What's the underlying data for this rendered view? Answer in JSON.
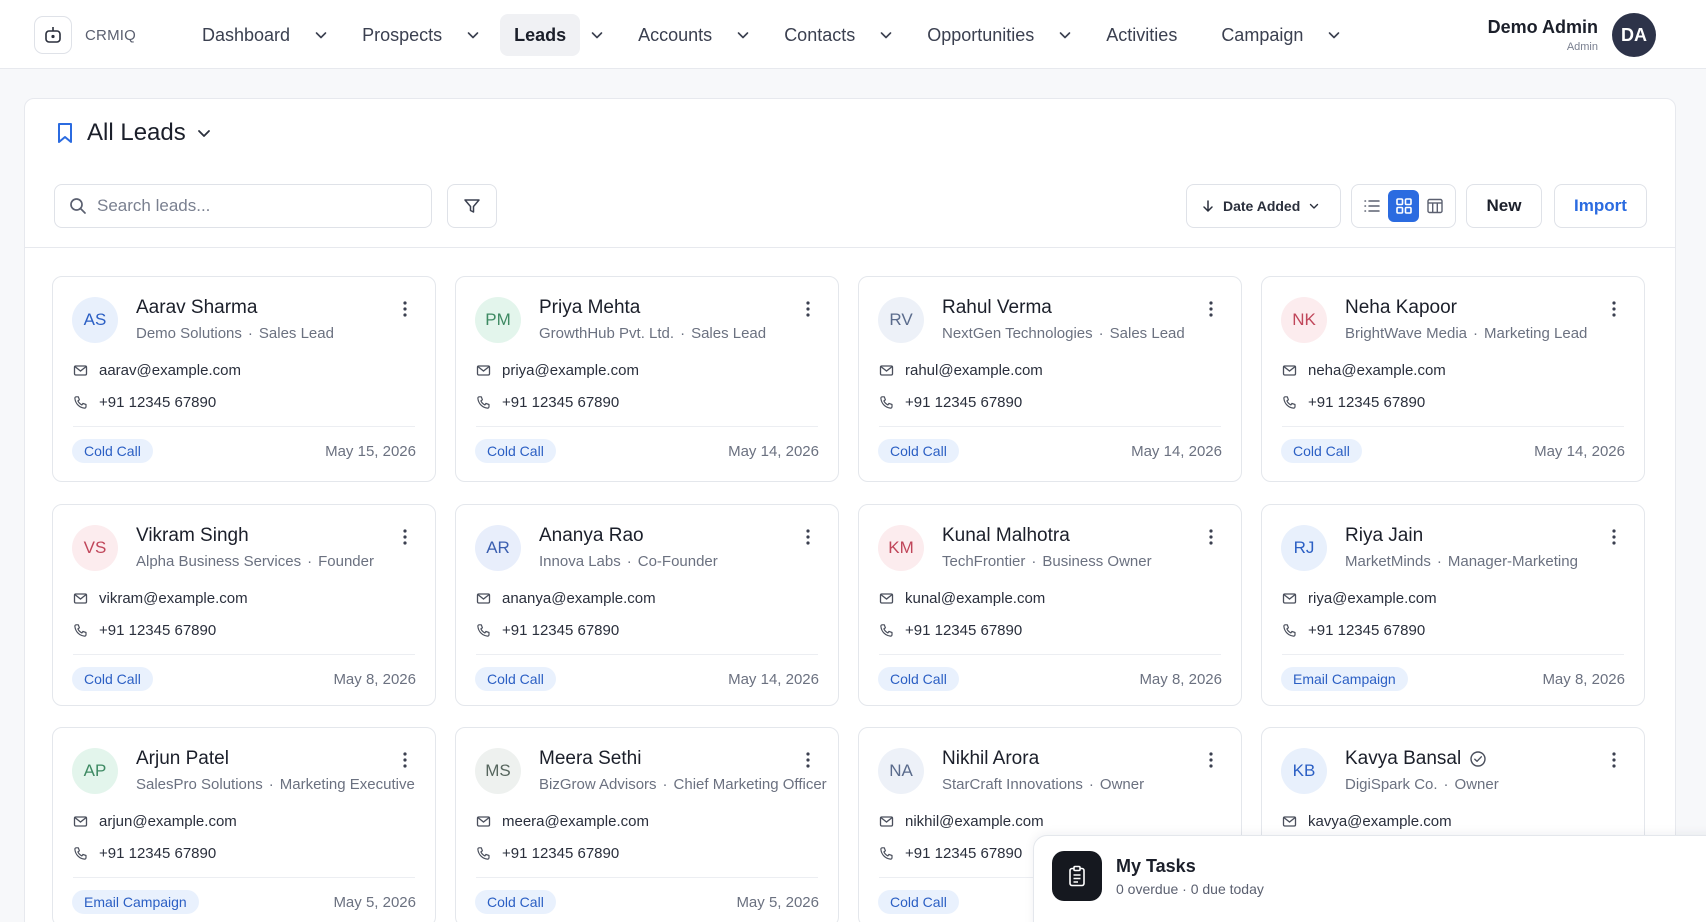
{
  "brand": {
    "name": "CRMIQ"
  },
  "nav": [
    {
      "label": "Dashboard",
      "chevron": true,
      "active": false
    },
    {
      "label": "Prospects",
      "chevron": true,
      "active": false
    },
    {
      "label": "Leads",
      "chevron": true,
      "active": true
    },
    {
      "label": "Accounts",
      "chevron": true,
      "active": false
    },
    {
      "label": "Contacts",
      "chevron": true,
      "active": false
    },
    {
      "label": "Opportunities",
      "chevron": true,
      "active": false
    },
    {
      "label": "Activities",
      "chevron": false,
      "active": false
    },
    {
      "label": "Campaign",
      "chevron": true,
      "active": false
    }
  ],
  "user": {
    "name": "Demo Admin",
    "role": "Admin",
    "initials": "DA"
  },
  "page": {
    "title": "All Leads"
  },
  "toolbar": {
    "search_placeholder": "Search leads...",
    "sort_label": "Date Added",
    "new_label": "New",
    "import_label": "Import",
    "active_view": "grid"
  },
  "leads": [
    {
      "initials": "AS",
      "name": "Aarav Sharma",
      "company": "Demo Solutions",
      "role": "Sales Lead",
      "email": "aarav@example.com",
      "phone": "+91 12345 67890",
      "source": "Cold Call",
      "date": "May 15, 2026",
      "avatar_bg": "#e8f0fc",
      "avatar_fg": "#2b5fc4",
      "verified": false
    },
    {
      "initials": "PM",
      "name": "Priya Mehta",
      "company": "GrowthHub Pvt. Ltd.",
      "role": "Sales Lead",
      "email": "priya@example.com",
      "phone": "+91 12345 67890",
      "source": "Cold Call",
      "date": "May 14, 2026",
      "avatar_bg": "#e3f5ec",
      "avatar_fg": "#3e8a63",
      "verified": false
    },
    {
      "initials": "RV",
      "name": "Rahul Verma",
      "company": "NextGen Technologies",
      "role": "Sales Lead",
      "email": "rahul@example.com",
      "phone": "+91 12345 67890",
      "source": "Cold Call",
      "date": "May 14, 2026",
      "avatar_bg": "#edf1f8",
      "avatar_fg": "#5a6b8c",
      "verified": false
    },
    {
      "initials": "NK",
      "name": "Neha Kapoor",
      "company": "BrightWave Media",
      "role": "Marketing Lead",
      "email": "neha@example.com",
      "phone": "+91 12345 67890",
      "source": "Cold Call",
      "date": "May 14, 2026",
      "avatar_bg": "#fcecee",
      "avatar_fg": "#c0465a",
      "verified": false
    },
    {
      "initials": "VS",
      "name": "Vikram Singh",
      "company": "Alpha Business Services",
      "role": "Founder",
      "email": "vikram@example.com",
      "phone": "+91 12345 67890",
      "source": "Cold Call",
      "date": "May 8, 2026",
      "avatar_bg": "#fcecee",
      "avatar_fg": "#c0465a",
      "verified": false
    },
    {
      "initials": "AR",
      "name": "Ananya Rao",
      "company": "Innova Labs",
      "role": "Co-Founder",
      "email": "ananya@example.com",
      "phone": "+91 12345 67890",
      "source": "Cold Call",
      "date": "May 14, 2026",
      "avatar_bg": "#e8eefb",
      "avatar_fg": "#3b5fb0",
      "verified": false
    },
    {
      "initials": "KM",
      "name": "Kunal Malhotra",
      "company": "TechFrontier",
      "role": "Business Owner",
      "email": "kunal@example.com",
      "phone": "+91 12345 67890",
      "source": "Cold Call",
      "date": "May 8, 2026",
      "avatar_bg": "#fcecee",
      "avatar_fg": "#c0465a",
      "verified": false
    },
    {
      "initials": "RJ",
      "name": "Riya Jain",
      "company": "MarketMinds",
      "role": "Manager-Marketing",
      "email": "riya@example.com",
      "phone": "+91 12345 67890",
      "source": "Email Campaign",
      "date": "May 8, 2026",
      "avatar_bg": "#e8f0fc",
      "avatar_fg": "#2b5fc4",
      "verified": false
    },
    {
      "initials": "AP",
      "name": "Arjun Patel",
      "company": "SalesPro Solutions",
      "role": "Marketing Executive",
      "email": "arjun@example.com",
      "phone": "+91 12345 67890",
      "source": "Email Campaign",
      "date": "May 5, 2026",
      "avatar_bg": "#e3f5ec",
      "avatar_fg": "#3e8a63",
      "verified": false
    },
    {
      "initials": "MS",
      "name": "Meera Sethi",
      "company": "BizGrow Advisors",
      "role": "Chief Marketing Officer",
      "email": "meera@example.com",
      "phone": "+91 12345 67890",
      "source": "Cold Call",
      "date": "May 5, 2026",
      "avatar_bg": "#eef1ef",
      "avatar_fg": "#56665e",
      "verified": false
    },
    {
      "initials": "NA",
      "name": "Nikhil Arora",
      "company": "StarCraft Innovations",
      "role": "Owner",
      "email": "nikhil@example.com",
      "phone": "+91 12345 67890",
      "source": "Cold Call",
      "date": "",
      "avatar_bg": "#edf1f8",
      "avatar_fg": "#5a6b8c",
      "verified": false
    },
    {
      "initials": "KB",
      "name": "Kavya Bansal",
      "company": "DigiSpark Co.",
      "role": "Owner",
      "email": "kavya@example.com",
      "phone": "",
      "source": "",
      "date": "",
      "avatar_bg": "#e8f0fc",
      "avatar_fg": "#2b5fc4",
      "verified": true
    }
  ],
  "tasks": {
    "title": "My Tasks",
    "summary": "0 overdue · 0 due today"
  }
}
